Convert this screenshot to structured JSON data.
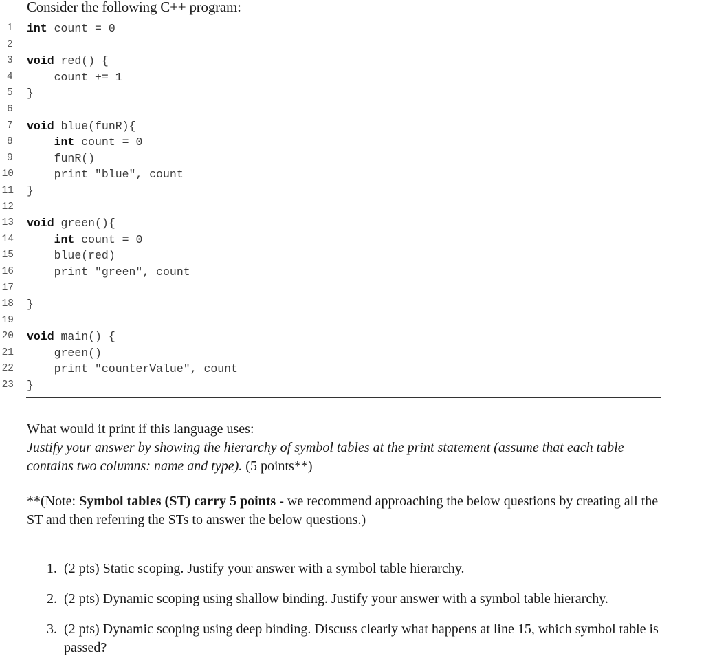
{
  "intro": "Consider the following C++ program:",
  "code": {
    "lines": [
      {
        "n": "1",
        "indent": "",
        "kw": "int",
        "rest": " count = 0"
      },
      {
        "n": "2",
        "indent": "",
        "kw": "",
        "rest": ""
      },
      {
        "n": "3",
        "indent": "",
        "kw": "void",
        "rest": " red() {"
      },
      {
        "n": "4",
        "indent": "    ",
        "kw": "",
        "rest": "count += 1"
      },
      {
        "n": "5",
        "indent": "",
        "kw": "",
        "rest": "}"
      },
      {
        "n": "6",
        "indent": "",
        "kw": "",
        "rest": ""
      },
      {
        "n": "7",
        "indent": "",
        "kw": "void",
        "rest": " blue(funR){"
      },
      {
        "n": "8",
        "indent": "    ",
        "kw": "int",
        "rest": " count = 0"
      },
      {
        "n": "9",
        "indent": "    ",
        "kw": "",
        "rest": "funR()"
      },
      {
        "n": "10",
        "indent": "    ",
        "kw": "",
        "rest": "print \"blue\", count"
      },
      {
        "n": "11",
        "indent": "",
        "kw": "",
        "rest": "}"
      },
      {
        "n": "12",
        "indent": "",
        "kw": "",
        "rest": ""
      },
      {
        "n": "13",
        "indent": "",
        "kw": "void",
        "rest": " green(){"
      },
      {
        "n": "14",
        "indent": "    ",
        "kw": "int",
        "rest": " count = 0"
      },
      {
        "n": "15",
        "indent": "    ",
        "kw": "",
        "rest": "blue(red)"
      },
      {
        "n": "16",
        "indent": "    ",
        "kw": "",
        "rest": "print \"green\", count"
      },
      {
        "n": "17",
        "indent": "",
        "kw": "",
        "rest": ""
      },
      {
        "n": "18",
        "indent": "",
        "kw": "",
        "rest": "}"
      },
      {
        "n": "19",
        "indent": "",
        "kw": "",
        "rest": ""
      },
      {
        "n": "20",
        "indent": "",
        "kw": "void",
        "rest": " main() {"
      },
      {
        "n": "21",
        "indent": "    ",
        "kw": "",
        "rest": "green()"
      },
      {
        "n": "22",
        "indent": "    ",
        "kw": "",
        "rest": "print \"counterValue\", count"
      },
      {
        "n": "23",
        "indent": "",
        "kw": "",
        "rest": "}"
      }
    ]
  },
  "question": {
    "prompt": "What would it print if this language uses:",
    "instruction": "Justify your answer by showing the hierarchy of symbol tables at the print statement (assume that each table contains two columns: name and type).",
    "points": " (5 points**)"
  },
  "note": {
    "prefix": "**(Note: ",
    "bold": "Symbol tables (ST) carry 5 points",
    "suffix": " - we recommend approaching the below questions by creating all the ST and then referring the STs to answer the below questions.)"
  },
  "items": [
    {
      "num": "1.",
      "text": "(2 pts) Static scoping. Justify your answer with a symbol table hierarchy."
    },
    {
      "num": "2.",
      "text": "(2 pts) Dynamic scoping using shallow binding. Justify your answer with a symbol table hierarchy."
    },
    {
      "num": "3.",
      "text": "(2 pts) Dynamic scoping using deep binding. Discuss clearly what happens at line 15, which symbol table is passed?"
    }
  ]
}
